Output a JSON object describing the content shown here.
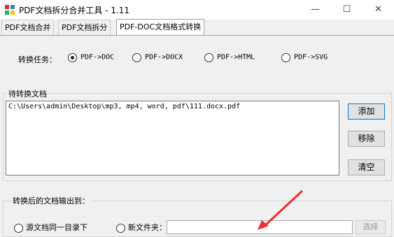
{
  "window": {
    "title": "PDF文档拆分合并工具 - 1.11",
    "minimize": "—",
    "maximize": "☐",
    "close": "✕"
  },
  "tabs": [
    {
      "label": "PDF文档合并"
    },
    {
      "label": "PDF文档拆分"
    },
    {
      "label": "PDF-DOC文档格式转换"
    }
  ],
  "task": {
    "label": "转换任务：",
    "options": [
      "PDF->DOC",
      "PDF->DOCX",
      "PDF->HTML",
      "PDF->SVG"
    ],
    "selected": "PDF->DOC"
  },
  "files_group": {
    "title": "待转换文档",
    "items": [
      "C:\\Users\\admin\\Desktop\\mp3, mp4, word, pdf\\111.docx.pdf"
    ]
  },
  "buttons": {
    "add": "添加",
    "remove": "移除",
    "clear": "清空"
  },
  "output_group": {
    "title": "转换后的文档输出到：",
    "same_dir": "源文档同一目录下",
    "new_folder": "新文件夹：",
    "browse": "选择"
  },
  "colors": {
    "arrow": "#e8312a",
    "accent": "#0078d7"
  }
}
